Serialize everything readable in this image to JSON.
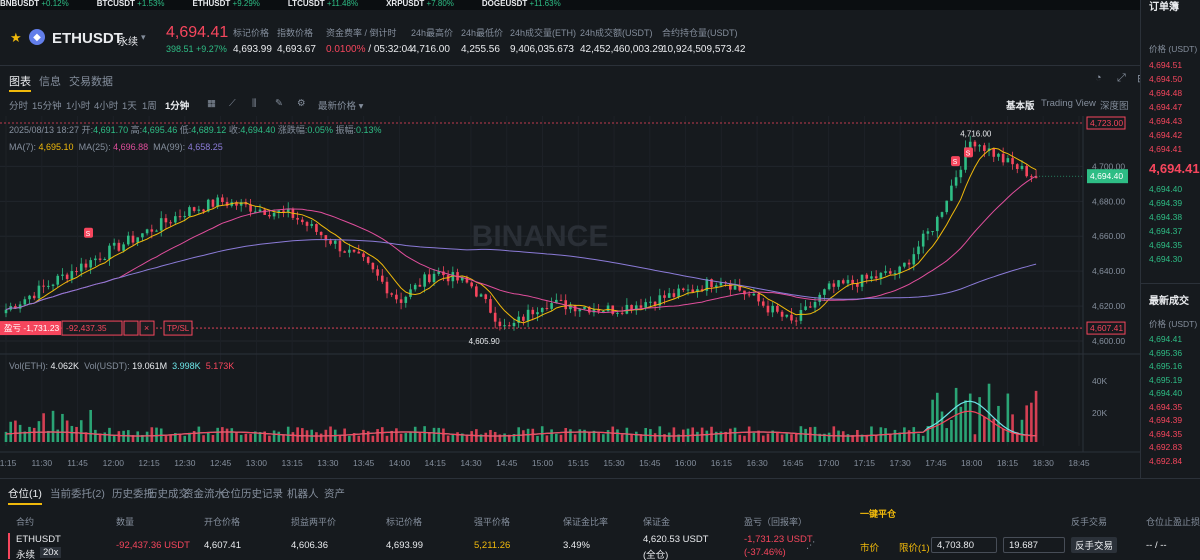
{
  "ticker": [
    {
      "sym": "BNBUSDT",
      "chg": "+0.12%",
      "up": true
    },
    {
      "sym": "BTCUSDT",
      "chg": "+1.53%",
      "up": true
    },
    {
      "sym": "ETHUSDT",
      "chg": "+9.29%",
      "up": true
    },
    {
      "sym": "LTCUSDT",
      "chg": "+11.48%",
      "up": true
    },
    {
      "sym": "XRPUSDT",
      "chg": "+7.80%",
      "up": true
    },
    {
      "sym": "DOGEUSDT",
      "chg": "+11.63%",
      "up": true
    }
  ],
  "header": {
    "symbol": "ETHUSDT",
    "contract": "永续",
    "last_price": "4,694.41",
    "change_abs": "398.51",
    "change_pct": "+9.27%",
    "stats": [
      {
        "label": "标记价格",
        "value": "4,693.99"
      },
      {
        "label": "指数价格",
        "value": "4,693.67"
      },
      {
        "label": "资金费率 / 倒计时",
        "value_a": "0.0100%",
        "value_b": " / 05:32:04"
      },
      {
        "label": "24h最高价",
        "value": "4,716.00"
      },
      {
        "label": "24h最低价",
        "value": "4,255.56"
      },
      {
        "label": "24h成交量(ETH)",
        "value": "9,406,035.673"
      },
      {
        "label": "24h成交额(USDT)",
        "value": "42,452,460,003.29"
      },
      {
        "label": "合约持仓量(USDT)",
        "value": "10,924,509,573.42"
      }
    ]
  },
  "tabs": [
    "图表",
    "信息",
    "交易数据"
  ],
  "toolbar": {
    "intervals": [
      "分时",
      "15分钟",
      "1小时",
      "4小时",
      "1天",
      "1周",
      "1分钟"
    ],
    "price_type": "最新价格",
    "views": [
      "基本版",
      "Trading View",
      "深度图"
    ]
  },
  "legend": {
    "ohlc": {
      "date": "2025/08/13 18:27",
      "open_l": "开:",
      "open": "4,691.70",
      "high_l": "高:",
      "high": "4,695.46",
      "low_l": "低:",
      "low": "4,689.12",
      "close_l": "收:",
      "close": "4,694.40",
      "chg_l": "涨跌幅:",
      "chg": "0.05%",
      "amp_l": "振幅:",
      "amp": "0.13%"
    },
    "ma": {
      "ma7_l": "MA(7):",
      "ma7": "4,695.10",
      "ma25_l": "MA(25):",
      "ma25": "4,696.88",
      "ma99_l": "MA(99):",
      "ma99": "4,658.25"
    },
    "vol": {
      "v_eth_l": "Vol(ETH):",
      "v_eth": "4.062K",
      "v_usdt_l": "Vol(USDT):",
      "v_usdt": "19.061M",
      "v1": "3.998K",
      "v2": "5.173K"
    }
  },
  "chart_data": {
    "type": "candlestick",
    "price_axis": {
      "ticks": [
        4600,
        4620,
        4640,
        4660,
        4680,
        4700
      ],
      "range": [
        4596,
        4726
      ]
    },
    "time_ticks": [
      "11:15",
      "11:30",
      "11:45",
      "12:00",
      "12:15",
      "12:30",
      "12:45",
      "13:00",
      "13:15",
      "13:30",
      "13:45",
      "14:00",
      "14:15",
      "14:30",
      "14:45",
      "15:00",
      "15:15",
      "15:30",
      "15:45",
      "16:00",
      "16:15",
      "16:30",
      "16:45",
      "17:00",
      "17:15",
      "17:30",
      "17:45",
      "18:00",
      "18:15",
      "18:30",
      "18:45"
    ],
    "volume_axis": {
      "ticks": [
        "20K",
        "40K"
      ]
    },
    "markers": {
      "high": "4,716.00",
      "low": "4,605.90",
      "top_line": "4,723.00",
      "current": "4,694.40",
      "position_line": "4,607.41",
      "sell_mark": "S"
    },
    "key_points": [
      {
        "t": "11:15",
        "p": 4618
      },
      {
        "t": "11:45",
        "p": 4642
      },
      {
        "t": "12:30",
        "p": 4674
      },
      {
        "t": "12:45",
        "p": 4680
      },
      {
        "t": "13:00",
        "p": 4676
      },
      {
        "t": "13:15",
        "p": 4672
      },
      {
        "t": "13:45",
        "p": 4645
      },
      {
        "t": "14:00",
        "p": 4623
      },
      {
        "t": "14:15",
        "p": 4640
      },
      {
        "t": "14:30",
        "p": 4632
      },
      {
        "t": "14:45",
        "p": 4606
      },
      {
        "t": "15:00",
        "p": 4622
      },
      {
        "t": "15:30",
        "p": 4618
      },
      {
        "t": "16:00",
        "p": 4628
      },
      {
        "t": "16:15",
        "p": 4636
      },
      {
        "t": "16:45",
        "p": 4610
      },
      {
        "t": "17:00",
        "p": 4630
      },
      {
        "t": "17:30",
        "p": 4640
      },
      {
        "t": "17:45",
        "p": 4668
      },
      {
        "t": "18:00",
        "p": 4716
      },
      {
        "t": "18:15",
        "p": 4702
      },
      {
        "t": "18:27",
        "p": 4694
      }
    ]
  },
  "position_tag": {
    "label": "盈亏 -1,731.23",
    "qty": "-92,437.35",
    "tpsl": "TP/SL"
  },
  "bottom": {
    "tabs": [
      "仓位(1)",
      "当前委托(2)",
      "历史委托",
      "历史成交",
      "资金流水",
      "仓位历史记录",
      "机器人",
      "资产"
    ],
    "columns": [
      "合约",
      "数量",
      "开仓价格",
      "损益两平价",
      "标记价格",
      "强平价格",
      "保证金比率",
      "保证金",
      "盈亏（回报率）",
      "一键平仓",
      "反手交易",
      "仓位止盈止损"
    ],
    "row": {
      "symbol": "ETHUSDT",
      "type": "永续",
      "lev": "20x",
      "qty": "-92,437.36 USDT",
      "entry": "4,607.41",
      "breakeven": "4,606.36",
      "mark": "4,693.99",
      "liq": "5,211.26",
      "margin_ratio": "3.49%",
      "margin": "4,620.53 USDT",
      "margin_mode": "(全仓)",
      "pnl": "-1,731.23 USDT",
      "roe": "(-37.46%)",
      "market": "市价",
      "limit": "限价(1)",
      "limit_price": "4,703.80",
      "limit_qty": "19.687",
      "reverse": "反手交易",
      "tpsl": "-- / --"
    }
  },
  "book": {
    "title": "订单簿",
    "hdr": "价格 (USDT)",
    "asks": [
      "4,694.51",
      "4,694.50",
      "4,694.48",
      "4,694.47",
      "4,694.43",
      "4,694.42",
      "4,694.41"
    ],
    "mid": "4,694.41",
    "bids": [
      "4,694.40",
      "4,694.39",
      "4,694.38",
      "4,694.37",
      "4,694.35",
      "4,694.30"
    ],
    "trades_title": "最新成交",
    "trades_hdr": "价格 (USDT)",
    "trades": [
      {
        "p": "4,694.41",
        "up": true
      },
      {
        "p": "4,695.36",
        "up": true
      },
      {
        "p": "4,695.16",
        "up": true
      },
      {
        "p": "4,695.19",
        "up": true
      },
      {
        "p": "4,694.40",
        "up": true
      },
      {
        "p": "4,694.35",
        "up": false
      },
      {
        "p": "4,694.39",
        "up": false
      },
      {
        "p": "4,694.35",
        "up": false
      },
      {
        "p": "4,692.83",
        "up": false
      },
      {
        "p": "4,692.84",
        "up": false
      }
    ]
  },
  "colors": {
    "up": "#2ebd85",
    "down": "#f6465d",
    "ma7": "#f0b90b",
    "ma25": "#e04e9c",
    "ma99": "#8b7bd8",
    "accent": "#f0b90b"
  }
}
